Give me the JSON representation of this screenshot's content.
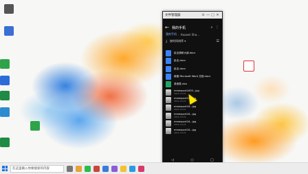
{
  "window": {
    "title": "文件管理器",
    "controls": [
      "⊙",
      "—",
      "▢",
      "✕"
    ]
  },
  "status_bar": {
    "left": "",
    "right": ""
  },
  "app_header": {
    "title": "我的手机"
  },
  "breadcrumb": {
    "items": [
      "我的手机",
      "Huawei Sha..."
    ]
  },
  "sort_bar": {
    "label": "按时间排序 ▾"
  },
  "files": [
    {
      "name": "民法调研大纲.docx",
      "meta": "",
      "type": "doc"
    },
    {
      "name": "民法.docx",
      "meta": "",
      "type": "doc"
    },
    {
      "name": "民法.docx",
      "meta": "",
      "type": "doc"
    },
    {
      "name": "新建 Microsoft Word 文档.docx",
      "meta": "",
      "type": "doc"
    },
    {
      "name": "录音表.xlsx",
      "meta": "",
      "type": "xls"
    },
    {
      "name": "mmexport1633...jpg",
      "meta": "2021-10-15",
      "type": "img"
    },
    {
      "name": "mmexport16...jpg",
      "meta": "2021-10-15",
      "type": "img"
    },
    {
      "name": "mmexport16...jpg",
      "meta": "2021-10-15",
      "type": "img"
    },
    {
      "name": "mmexport16...jpg",
      "meta": "2021-10-15",
      "type": "img"
    },
    {
      "name": "mmexport16...jpg",
      "meta": "2021-10-15",
      "type": "img"
    },
    {
      "name": "mmexport16...jpg",
      "meta": "2021-10-15",
      "type": "img"
    }
  ],
  "nav_buttons": [
    "◁",
    "○",
    "□"
  ],
  "taskbar": {
    "search_placeholder": "在这里输入你要搜索的内容"
  }
}
